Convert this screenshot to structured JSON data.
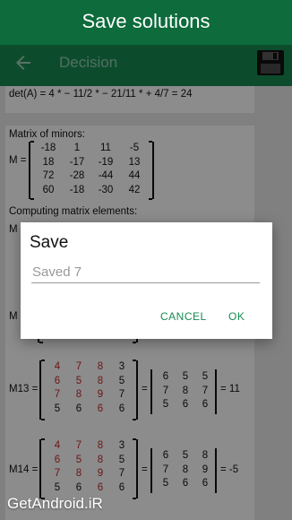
{
  "banner": {
    "text": "Save solutions"
  },
  "toolbar": {
    "title": "Decision"
  },
  "solution": {
    "det_line": "det(A) = 4 * − 11/2 * − 21/11 * + 4/7 = 24",
    "minors_label": "Matrix of minors:",
    "m_label": "M =",
    "minors": [
      [
        "-18",
        "1",
        "11",
        "-5"
      ],
      [
        "18",
        "-17",
        "-19",
        "13"
      ],
      [
        "72",
        "-28",
        "-44",
        "44"
      ],
      [
        "60",
        "-18",
        "-30",
        "42"
      ]
    ],
    "computing_label": "Computing matrix elements:",
    "m13": {
      "label": "M13 =",
      "matrix": [
        [
          "4",
          "7",
          "8",
          "3"
        ],
        [
          "6",
          "5",
          "8",
          "5"
        ],
        [
          "7",
          "8",
          "9",
          "7"
        ],
        [
          "5",
          "6",
          "6",
          "6"
        ]
      ],
      "det": [
        [
          "6",
          "5",
          "5"
        ],
        [
          "7",
          "8",
          "7"
        ],
        [
          "5",
          "6",
          "6"
        ]
      ],
      "result": "= 11"
    },
    "m14": {
      "label": "M14 =",
      "matrix": [
        [
          "4",
          "7",
          "8",
          "3"
        ],
        [
          "6",
          "5",
          "8",
          "5"
        ],
        [
          "7",
          "8",
          "9",
          "7"
        ],
        [
          "5",
          "6",
          "6",
          "6"
        ]
      ],
      "det": [
        [
          "6",
          "5",
          "8"
        ],
        [
          "7",
          "8",
          "9"
        ],
        [
          "5",
          "6",
          "6"
        ]
      ],
      "result": "= -5"
    },
    "partial_row": [
      "5",
      "6",
      "6",
      "6"
    ]
  },
  "dialog": {
    "title": "Save",
    "input_value": "Saved 7",
    "cancel_label": "CANCEL",
    "ok_label": "OK"
  },
  "watermark": {
    "text": "GetAndroid.iR"
  },
  "colors": {
    "banner": "#0d6b3c",
    "appbar": "#168a52",
    "accent": "#168a52",
    "highlight": "#c62828"
  }
}
